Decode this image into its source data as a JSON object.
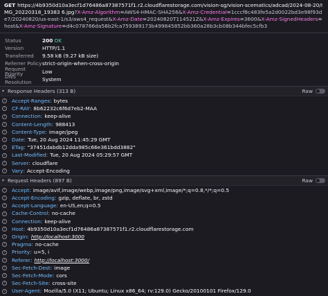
{
  "request": {
    "method": "GET",
    "url_base": "https://4b9350d10a3ecf1d76486a87387571f1.r2.cloudflarestorage.com/vision-sg/vision-scematics/adcad/2024-08-20/IMG_20220318_19383 6.jpg",
    "params": [
      {
        "name": "X-Amz-Algorithm",
        "value": "AWS4-HMAC-SHA256"
      },
      {
        "name": "X-Amz-Credential",
        "value": "1cccf8c483fe5a2d0022bd3e98f93de7/20240820/us-east-1/s3/aws4_request"
      },
      {
        "name": "X-Amz-Date",
        "value": "20240820T114521Z"
      },
      {
        "name": "X-Amz-Expires",
        "value": "3600"
      },
      {
        "name": "X-Amz-SignedHeaders",
        "value": "host"
      },
      {
        "name": "X-Amz-Signature",
        "value": "d4c078766da58b2fca759389173b499845852bb360a28b3cb08b344bfec5cfb3"
      }
    ]
  },
  "summary": {
    "status_label": "Status",
    "status_code": "200",
    "status_text": "OK",
    "version_label": "Version",
    "version_value": "HTTP/1.1",
    "transferred_label": "Transferred",
    "transferred_value": "9.58 kB (9.27 kB size)",
    "referrer_label": "Referrer Policy",
    "referrer_value": "strict-origin-when-cross-origin",
    "priority_label": "Request Priority",
    "priority_value": "Low",
    "dns_label": "DNS Resolution",
    "dns_value": "System"
  },
  "response_headers": {
    "title": "Response Headers (313 B)",
    "raw_label": "Raw",
    "items": [
      {
        "name": "Accept-Ranges",
        "value": "bytes"
      },
      {
        "name": "CF-RAY",
        "value": "8b62232c6f6d7eb2-MAA"
      },
      {
        "name": "Connection",
        "value": "keep-alive"
      },
      {
        "name": "Content-Length",
        "value": "988413"
      },
      {
        "name": "Content-Type",
        "value": "image/jpeg"
      },
      {
        "name": "Date",
        "value": "Tue, 20 Aug 2024 11:45:29 GMT"
      },
      {
        "name": "ETag",
        "value": "\"37451dabdb12dda985c66e361bdd3882\""
      },
      {
        "name": "Last-Modified",
        "value": "Tue, 20 Aug 2024 05:29:57 GMT"
      },
      {
        "name": "Server",
        "value": "cloudflare"
      },
      {
        "name": "Vary",
        "value": "Accept-Encoding"
      }
    ]
  },
  "request_headers": {
    "title": "Request Headers (897 B)",
    "raw_label": "Raw",
    "items": [
      {
        "name": "Accept",
        "value": "image/avif,image/webp,image/png,image/svg+xml,image/*;q=0.8,*/*;q=0.5"
      },
      {
        "name": "Accept-Encoding",
        "value": "gzip, deflate, br, zstd"
      },
      {
        "name": "Accept-Language",
        "value": "en-US,en;q=0.5"
      },
      {
        "name": "Cache-Control",
        "value": "no-cache"
      },
      {
        "name": "Connection",
        "value": "keep-alive"
      },
      {
        "name": "Host",
        "value": "4b9350d10a3ecf1d76486a87387571f1.r2.cloudflarestorage.com"
      },
      {
        "name": "Origin",
        "value": "http://localhost:3000",
        "link": true
      },
      {
        "name": "Pragma",
        "value": "no-cache"
      },
      {
        "name": "Priority",
        "value": "u=5, i"
      },
      {
        "name": "Referer",
        "value": "http://localhost:3000/",
        "link": true
      },
      {
        "name": "Sec-Fetch-Dest",
        "value": "image"
      },
      {
        "name": "Sec-Fetch-Mode",
        "value": "cors"
      },
      {
        "name": "Sec-Fetch-Site",
        "value": "cross-site"
      },
      {
        "name": "User-Agent",
        "value": "Mozilla/5.0 (X11; Ubuntu; Linux x86_64; rv:129.0) Gecko/20100101 Firefox/129.0"
      }
    ]
  },
  "icons": {
    "help": "?",
    "chevron": "▾"
  }
}
